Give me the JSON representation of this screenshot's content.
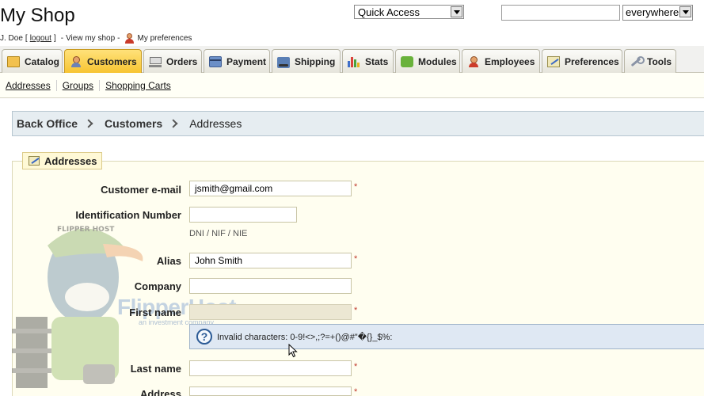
{
  "header": {
    "shop_title": "My Shop",
    "user_name": "J. Doe",
    "bracket_open": "[",
    "logout": "logout",
    "bracket_close": "]",
    "dash1": "-",
    "view_shop": "View my shop",
    "dash2": "-",
    "preferences": "My preferences",
    "quick_access": "Quick Access",
    "search_value": "",
    "search_scope": "everywhere"
  },
  "tabs": [
    {
      "label": "Catalog",
      "icon": "folder-icon"
    },
    {
      "label": "Customers",
      "icon": "customer-icon",
      "active": true
    },
    {
      "label": "Orders",
      "icon": "cart-icon"
    },
    {
      "label": "Payment",
      "icon": "credit-card-icon"
    },
    {
      "label": "Shipping",
      "icon": "truck-icon"
    },
    {
      "label": "Stats",
      "icon": "bar-chart-icon"
    },
    {
      "label": "Modules",
      "icon": "puzzle-icon"
    },
    {
      "label": "Employees",
      "icon": "employee-icon"
    },
    {
      "label": "Preferences",
      "icon": "pencil-icon"
    },
    {
      "label": "Tools",
      "icon": "wrench-icon"
    }
  ],
  "subtabs": [
    "Addresses",
    "Groups",
    "Shopping Carts"
  ],
  "breadcrumb": [
    "Back Office",
    "Customers",
    "Addresses"
  ],
  "form": {
    "legend": "Addresses",
    "customer_email_label": "Customer e-mail",
    "customer_email_value": "jsmith@gmail.com",
    "id_number_label": "Identification Number",
    "id_number_value": "",
    "id_number_hint": "DNI / NIF / NIE",
    "alias_label": "Alias",
    "alias_value": "John Smith",
    "company_label": "Company",
    "company_value": "",
    "first_name_label": "First name",
    "first_name_value": "",
    "tooltip_text": "Invalid characters: 0-9!<>,;?=+()@#\"�{}_$%:",
    "last_name_label": "Last name",
    "last_name_value": "",
    "address_label": "Address",
    "address_value": "",
    "required_mark": "*"
  },
  "watermark": {
    "cap_text": "FLIPPER HOST",
    "brand": "FlipperHost",
    "tagline": "an investment company"
  },
  "colors": {
    "active_tab": "#f7c531",
    "breadcrumb_bg": "#e6edf1",
    "form_bg": "#fffef0",
    "tooltip_bg": "#dfe8f3",
    "required": "#c0392b"
  }
}
